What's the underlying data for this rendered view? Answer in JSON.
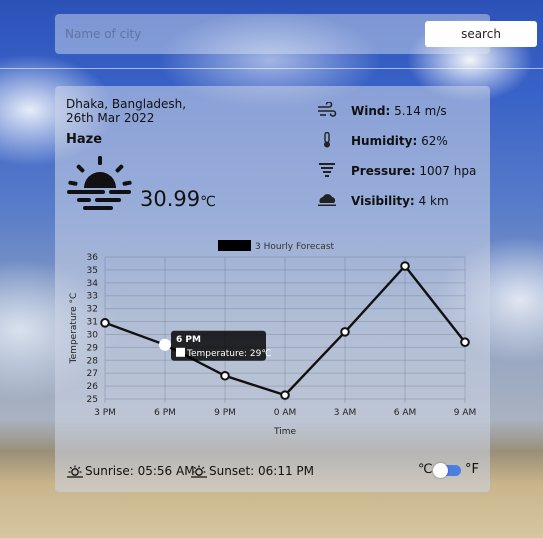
{
  "search": {
    "placeholder": "Name of city",
    "button_label": "search"
  },
  "weather": {
    "location": "Dhaka, Bangladesh,",
    "date": "26th Mar 2022",
    "condition": "Haze",
    "icon": "haze-icon",
    "temperature": "30.99",
    "temp_unit": "℃"
  },
  "details": [
    {
      "icon": "wind-icon",
      "label": "Wind:",
      "value": "5.14 m/s"
    },
    {
      "icon": "humidity-icon",
      "label": "Humidity:",
      "value": "62%"
    },
    {
      "icon": "pressure-icon",
      "label": "Pressure:",
      "value": "1007 hpa"
    },
    {
      "icon": "visibility-icon",
      "label": "Visibility:",
      "value": "4 km"
    }
  ],
  "chart_data": {
    "type": "line",
    "title": "",
    "legend": "3 Hourly Forecast",
    "legend_placement": "top",
    "categories": [
      "3 PM",
      "6 PM",
      "9 PM",
      "0 AM",
      "3 AM",
      "6 AM",
      "9 AM"
    ],
    "series": [
      {
        "name": "3 Hourly Forecast",
        "values": [
          30.9,
          29.2,
          26.8,
          25.3,
          30.2,
          35.3,
          29.4
        ]
      }
    ],
    "xlabel": "Time",
    "ylabel": "Temperature °C",
    "ylim": [
      25,
      36
    ],
    "yticks": [
      25,
      26,
      27,
      28,
      29,
      30,
      31,
      32,
      33,
      34,
      35,
      36
    ],
    "grid": true,
    "line_color": "#111111",
    "tooltip": {
      "category_index": 1,
      "title": "6 PM",
      "body": "Temperature: 29℃"
    }
  },
  "footer": {
    "sunrise": "Sunrise: 05:56 AM",
    "sunset": "Sunset: 06:11 PM",
    "unit_c": "℃",
    "unit_f": "°F",
    "toggle_state": "celsius"
  },
  "colors": {
    "toggle_accent": "#4a7ee3",
    "search_button_bg": "#ffffff"
  }
}
